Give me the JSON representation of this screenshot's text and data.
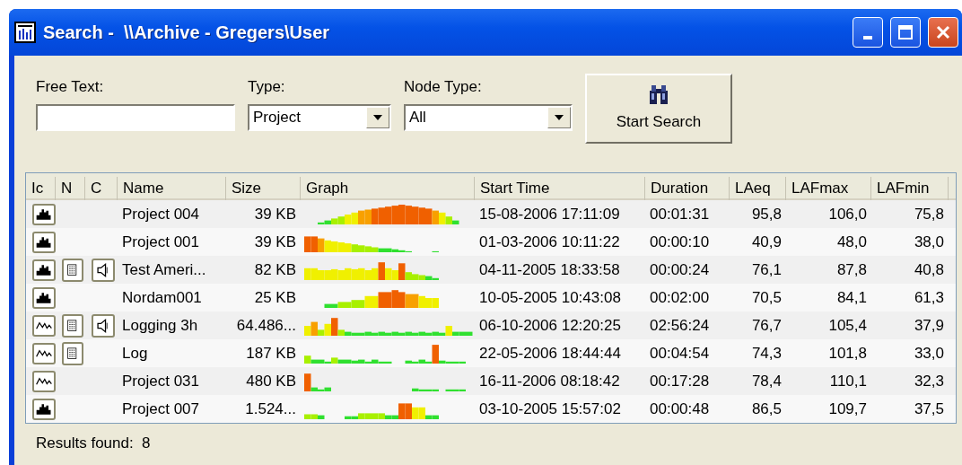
{
  "window": {
    "title": "Search -  \\\\Archive - Gregers\\User"
  },
  "form": {
    "free_text": {
      "label": "Free Text:"
    },
    "type": {
      "label": "Type:",
      "value": "Project"
    },
    "node_type": {
      "label": "Node Type:",
      "value": "All"
    },
    "search_button": "Start Search"
  },
  "table": {
    "columns": [
      "Ic",
      "N",
      "C",
      "Name",
      "Size",
      "Graph",
      "Start Time",
      "Duration",
      "LAeq",
      "LAFmax",
      "LAFmin"
    ],
    "rows": [
      {
        "kind": "project",
        "note": false,
        "sound": false,
        "name": "Project 004",
        "size": "39 KB",
        "start_time": "15-08-2006 17:11:09",
        "duration": "00:01:31",
        "laeq": "95,8",
        "lafmax": "106,0",
        "lafmin": "75,8"
      },
      {
        "kind": "project",
        "note": false,
        "sound": false,
        "name": "Project 001",
        "size": "39 KB",
        "start_time": "01-03-2006 10:11:22",
        "duration": "00:00:10",
        "laeq": "40,9",
        "lafmax": "48,0",
        "lafmin": "38,0"
      },
      {
        "kind": "project",
        "note": true,
        "sound": true,
        "name": "Test Ameri...",
        "size": "82 KB",
        "start_time": "04-11-2005 18:33:58",
        "duration": "00:00:24",
        "laeq": "76,1",
        "lafmax": "87,8",
        "lafmin": "40,8"
      },
      {
        "kind": "project",
        "note": false,
        "sound": false,
        "name": "Nordam001",
        "size": "25 KB",
        "start_time": "10-05-2005 10:43:08",
        "duration": "00:02:00",
        "laeq": "70,5",
        "lafmax": "84,1",
        "lafmin": "61,3"
      },
      {
        "kind": "logging",
        "note": true,
        "sound": true,
        "name": "Logging 3h",
        "size": "64.486...",
        "start_time": "06-10-2006 12:20:25",
        "duration": "02:56:24",
        "laeq": "76,7",
        "lafmax": "105,4",
        "lafmin": "37,9"
      },
      {
        "kind": "logging",
        "note": true,
        "sound": false,
        "name": "Log",
        "size": "187 KB",
        "start_time": "22-05-2006 18:44:44",
        "duration": "00:04:54",
        "laeq": "74,3",
        "lafmax": "101,8",
        "lafmin": "33,0"
      },
      {
        "kind": "logging",
        "note": false,
        "sound": false,
        "name": "Project 031",
        "size": "480 KB",
        "start_time": "16-11-2006 08:18:42",
        "duration": "00:17:28",
        "laeq": "78,4",
        "lafmax": "110,1",
        "lafmin": "32,3"
      },
      {
        "kind": "project",
        "note": false,
        "sound": false,
        "name": "Project 007",
        "size": "1.524...",
        "start_time": "03-10-2005 15:57:02",
        "duration": "00:00:48",
        "laeq": "86,5",
        "lafmax": "109,7",
        "lafmin": "37,5"
      }
    ]
  },
  "status_bar": {
    "text": "Results found:  8"
  }
}
